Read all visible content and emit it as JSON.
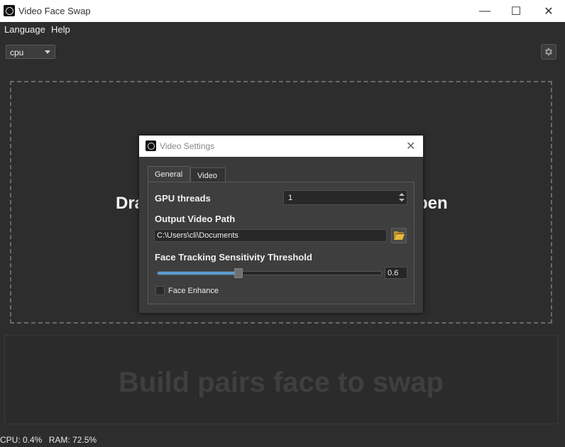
{
  "window": {
    "title": "Video Face Swap",
    "minimize": "—",
    "maximize": "☐",
    "close": "✕"
  },
  "menu": {
    "items": [
      "Language",
      "Help"
    ]
  },
  "toolbar": {
    "device_value": "cpu"
  },
  "main": {
    "dropzone_left": "Dra",
    "dropzone_right": "pen",
    "pairs_placeholder": "Build pairs face to swap"
  },
  "status": {
    "cpu": "CPU: 0.4%",
    "ram": "RAM: 72.5%"
  },
  "dialog": {
    "title": "Video Settings",
    "close": "✕",
    "tabs": [
      {
        "label": "General",
        "active": true
      },
      {
        "label": "Video",
        "active": false
      }
    ],
    "general": {
      "gpu_threads_label": "GPU threads",
      "gpu_threads_value": "1",
      "output_path_label": "Output Video Path",
      "output_path_value": "C:\\Users\\cli\\Documents",
      "sensitivity_label": "Face Tracking Sensitivity Threshold",
      "sensitivity_value": "0.6",
      "sensitivity_fraction": 0.36,
      "face_enhance_label": "Face Enhance",
      "face_enhance_checked": false
    }
  },
  "colors": {
    "background": "#2d2d2d",
    "accent": "#5a9bd4",
    "folder": "#e8b93a"
  }
}
